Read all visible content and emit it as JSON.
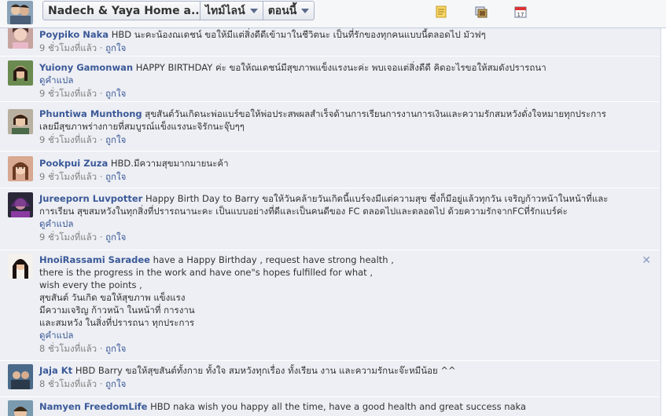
{
  "topbar": {
    "page_title": "Nadech & Yaya Home a...",
    "timeline_label": "ไทม์ไลน์",
    "now_label": "ตอนนี้",
    "calendar_day": "17"
  },
  "comments": [
    {
      "author": "Poypiko Naka",
      "lines": [
        "HBD นะคะน้องณเดชน์ ขอให้มีแต่สิ่งดีดีเข้ามาในชีวิตนะ เป็นที่รักของทุกคนแบบนี้ตลอดไป มัวฟๆ"
      ],
      "translate": "",
      "time": "9 ชั่วโมงที่แล้ว",
      "like": "ถูกใจ"
    },
    {
      "author": "Yuiony Gamonwan",
      "lines": [
        "HAPPY BIRTHDAY ค่ะ ขอให้ณเดชน์มีสุขภาพแข็งแรงนะค่ะ พบเจอแต่สิ่งดีดี คิดอะไรขอให้สมดังปรารถนา"
      ],
      "translate": "ดูคำแปล",
      "time": "9 ชั่วโมงที่แล้ว",
      "like": "ถูกใจ"
    },
    {
      "author": "Phuntiwa Munthong",
      "lines": [
        "สุขสันต์วันเกิดนะพ่อแบร์ขอให้พ่อประสพผลสำเร็จด้านการเรียนการงานการเงินและความรักสมหวังดั่งใจหมายทุกประการ",
        "เลยมีสุขภาพร่างกายที่สมบูรณ์แข็งแรงนะจิรักนะจุ๊บๆๆ"
      ],
      "translate": "",
      "time": "9 ชั่วโมงที่แล้ว",
      "like": "ถูกใจ"
    },
    {
      "author": "Pookpui Zuza",
      "lines": [
        "HBD.มีความสุขมากมายนะค้า"
      ],
      "translate": "",
      "time": "9 ชั่วโมงที่แล้ว",
      "like": "ถูกใจ"
    },
    {
      "author": "Jureeporn Luvpotter",
      "lines": [
        "Happy Birth Day to Barry ขอให้วันคล้ายวันเกิดนี้แบร์จงมีแต่ความสุข ซึ่งก็มีอยู่แล้วทุกวัน เจริญก้าวหน้าในหน้าที่และ",
        "การเรียน สุขสมหวังในทุกสิ่งที่ปรารถนานะคะ เป็นแบบอย่างที่ดีและเป็นคนดีของ FC ตลอดไปและตลอดไป ด้วยความรักจากFCที่รักแบร์ค่ะ"
      ],
      "translate": "ดูคำแปล",
      "time": "9 ชั่วโมงที่แล้ว",
      "like": "ถูกใจ"
    },
    {
      "author": "HnoiRassami Saradee",
      "lines": [
        "have a Happy Birthday , request have strong health ,",
        "there is the progress in the work and have one\"s hopes fulfilled for what ,",
        "wish every the points ,",
        "สุขสันต์ วันเกิด ขอให้สุขภาพ แข็งแรง",
        "มีความเจริญ ก้าวหน้า ในหน้าที่ การงาน",
        "และสมหวัง ในสิ่งที่ปรารถนา ทุกประการ"
      ],
      "translate": "ดูคำแปล",
      "time": "8 ชั่วโมงที่แล้ว",
      "like": "ถูกใจ"
    },
    {
      "author": "Jaja Kt",
      "lines": [
        "HBD Barry ขอให้สุขสันต์ทั้งกาย ทั้งใจ สมหวังทุกเรื่อง ทั้งเรียน งาน และความรักนะจ๊ะหมีน้อย ^^"
      ],
      "translate": "",
      "time": "8 ชั่วโมงที่แล้ว",
      "like": "ถูกใจ"
    },
    {
      "author": "Namyen FreedomLife",
      "lines": [
        "HBD naka wish you happy all the time, have a good health and great success naka"
      ],
      "translate": "",
      "time": "",
      "like": ""
    }
  ],
  "colors": {
    "link": "#3b5998",
    "meta": "#808080",
    "background": "#edeff4"
  }
}
